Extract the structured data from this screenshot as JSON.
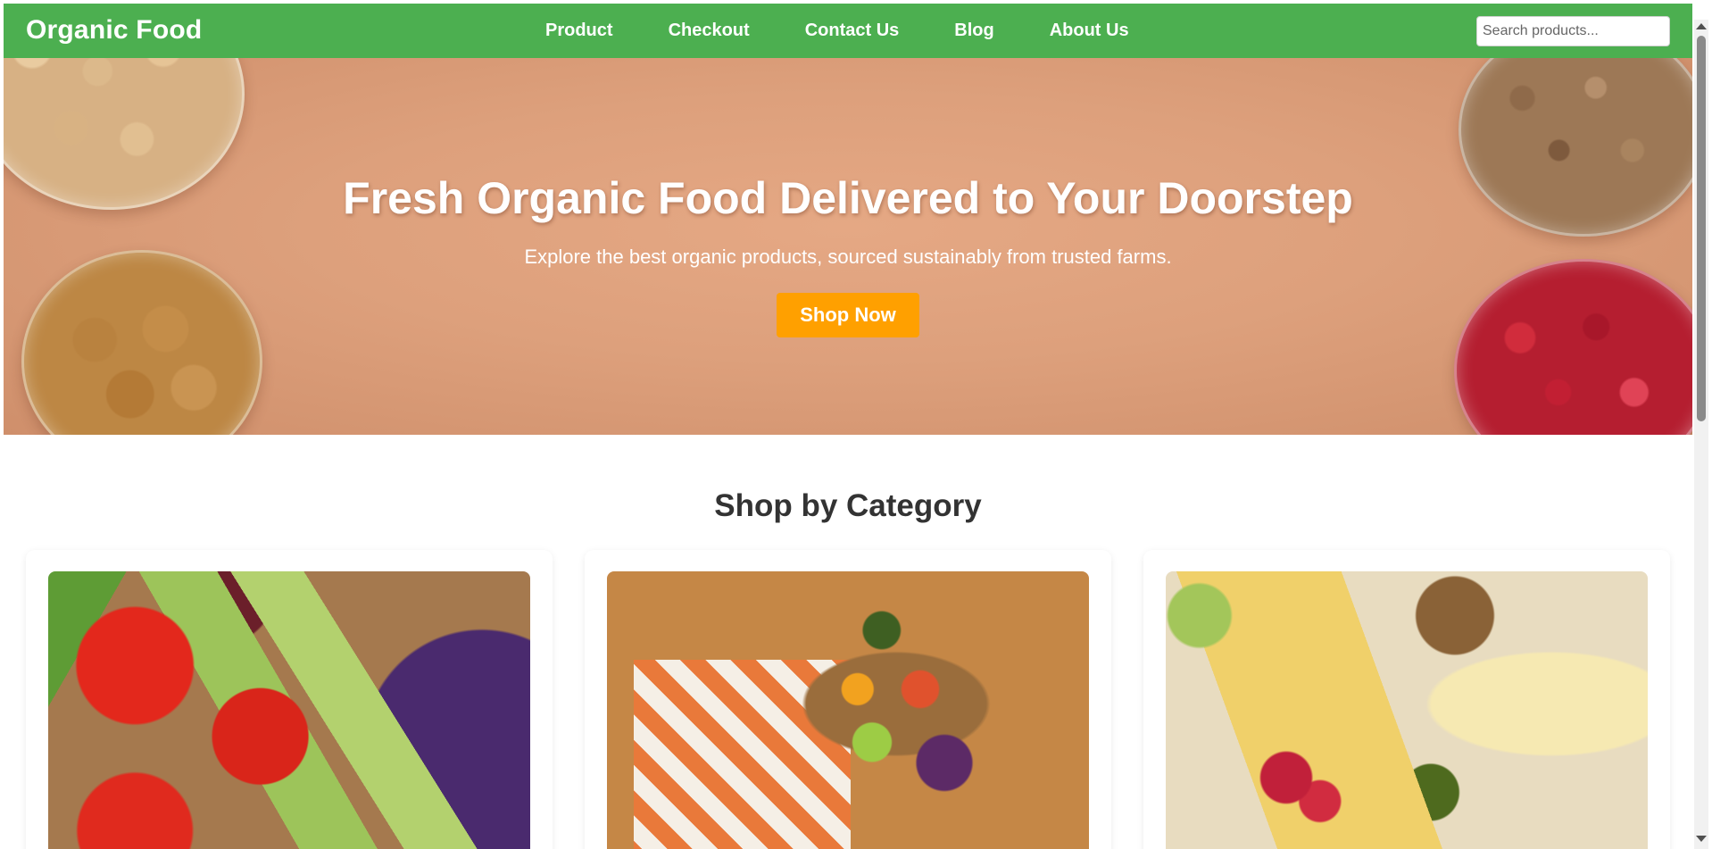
{
  "header": {
    "brand": "Organic Food",
    "nav": [
      "Product",
      "Checkout",
      "Contact Us",
      "Blog",
      "About Us"
    ],
    "search_placeholder": "Search products..."
  },
  "hero": {
    "title": "Fresh Organic Food Delivered to Your Doorstep",
    "subtitle": "Explore the best organic products, sourced sustainably from trusted farms.",
    "cta_label": "Shop Now"
  },
  "categories": {
    "title": "Shop by Category"
  },
  "colors": {
    "primary": "#4caf50",
    "accent": "#ffa000"
  }
}
